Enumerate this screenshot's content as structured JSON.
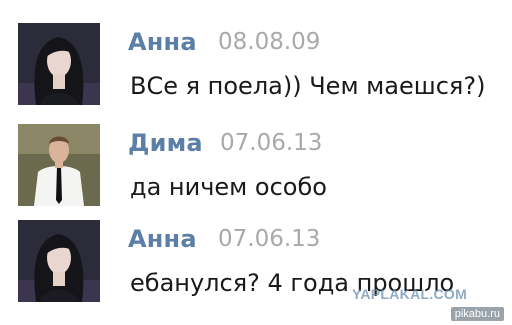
{
  "messages": [
    {
      "author": "Анна",
      "date": "08.08.09",
      "text": "ВСе я поела)) Чем маешся?)",
      "avatar_icon": "girl-avatar"
    },
    {
      "author": "Дима",
      "date": "07.06.13",
      "text": "да ничем особо",
      "avatar_icon": "boy-avatar"
    },
    {
      "author": "Анна",
      "date": "07.06.13",
      "text": "ебанулся? 4 года прошло",
      "avatar_icon": "girl-avatar"
    }
  ],
  "watermarks": {
    "site": "YAPLAKAL.COM",
    "source": "pikabu.ru"
  },
  "colors": {
    "author_name": "#5b7fa6",
    "date": "#a9a9a9",
    "text": "#1a1a1a"
  }
}
